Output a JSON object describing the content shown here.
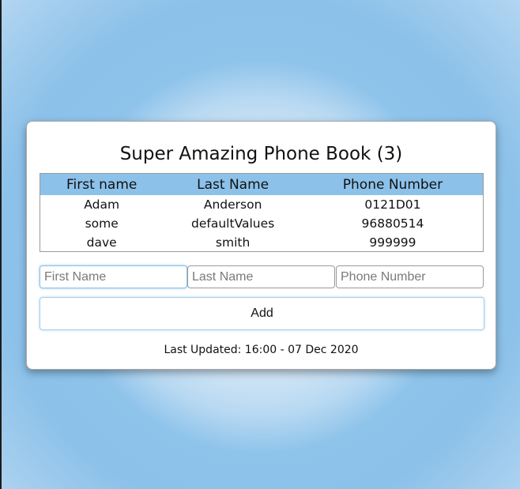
{
  "app": {
    "title": "Super Amazing Phone Book (3)"
  },
  "table": {
    "headers": [
      "First name",
      "Last Name",
      "Phone Number"
    ],
    "rows": [
      [
        "Adam",
        "Anderson",
        "0121D01"
      ],
      [
        "some",
        "defaultValues",
        "96880514"
      ],
      [
        "dave",
        "smith",
        "999999"
      ]
    ]
  },
  "form": {
    "first_name_placeholder": "First Name",
    "last_name_placeholder": "Last Name",
    "phone_placeholder": "Phone Number",
    "add_label": "Add"
  },
  "footer": {
    "last_updated": "Last Updated: 16:00 - 07 Dec 2020"
  },
  "colors": {
    "accent": "#8cc1e9",
    "background_light": "#dcecf8"
  }
}
